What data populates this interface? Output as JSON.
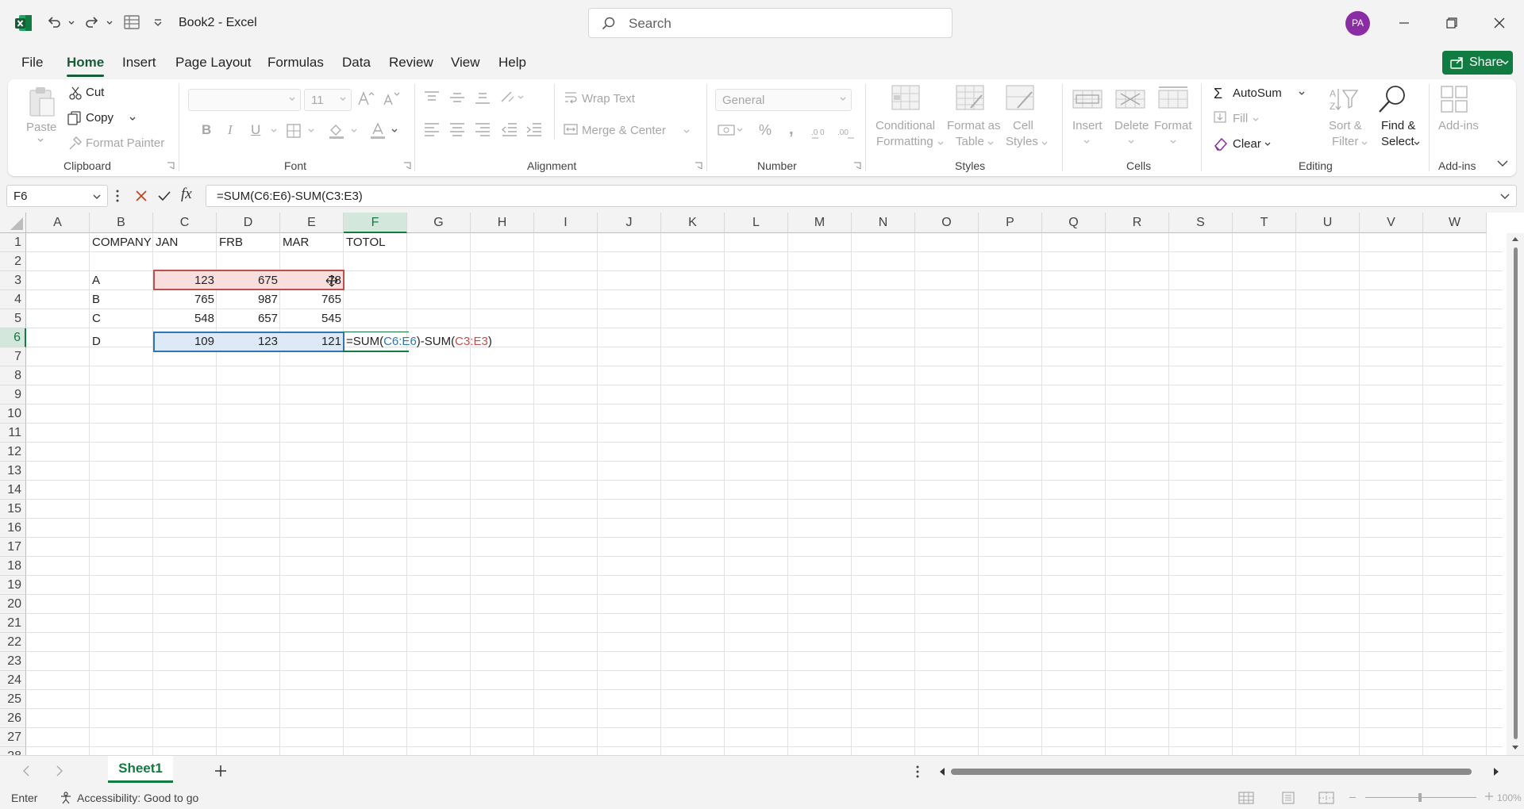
{
  "app": {
    "title": "Book2  -  Excel",
    "search_placeholder": "Search",
    "user_initials": "PA",
    "share_label": "Share"
  },
  "tabs": [
    "File",
    "Home",
    "Insert",
    "Page Layout",
    "Formulas",
    "Data",
    "Review",
    "View",
    "Help"
  ],
  "ribbon": {
    "clipboard": {
      "paste": "Paste",
      "cut": "Cut",
      "copy": "Copy",
      "format_painter": "Format Painter",
      "label": "Clipboard"
    },
    "font": {
      "name": "",
      "size": "11",
      "label": "Font"
    },
    "alignment": {
      "wrap_text": "Wrap Text",
      "merge_center": "Merge & Center",
      "label": "Alignment"
    },
    "number": {
      "format": "General",
      "label": "Number"
    },
    "styles": {
      "conditional_1": "Conditional",
      "conditional_2": "Formatting",
      "format_table_1": "Format as",
      "format_table_2": "Table",
      "cell_styles_1": "Cell",
      "cell_styles_2": "Styles",
      "label": "Styles"
    },
    "cells": {
      "insert": "Insert",
      "delete": "Delete",
      "format": "Format",
      "label": "Cells"
    },
    "editing": {
      "autosum": "AutoSum",
      "fill": "Fill",
      "clear": "Clear",
      "sort_1": "Sort &",
      "sort_2": "Filter",
      "find_1": "Find &",
      "find_2": "Select",
      "label": "Editing"
    },
    "addins": {
      "label_btn": "Add-ins",
      "label": "Add-ins"
    }
  },
  "formula_bar": {
    "name_box": "F6",
    "formula": "=SUM(C6:E6)-SUM(C3:E3)"
  },
  "columns": [
    "A",
    "B",
    "C",
    "D",
    "E",
    "F",
    "G",
    "H",
    "I",
    "J",
    "K",
    "L",
    "M",
    "N",
    "O",
    "P",
    "Q",
    "R",
    "S",
    "T",
    "U",
    "V",
    "W"
  ],
  "rows": [
    "1",
    "2",
    "3",
    "4",
    "5",
    "6",
    "7",
    "8",
    "9",
    "10",
    "11",
    "12",
    "13",
    "14",
    "15",
    "16",
    "17",
    "18",
    "19",
    "20",
    "21",
    "22",
    "23",
    "24",
    "25",
    "26",
    "27",
    "28"
  ],
  "cells": {
    "B1": "COMPANY",
    "C1": "JAN",
    "D1": "FRB",
    "E1": "MAR",
    "F1": "TOTOL",
    "B3": "A",
    "C3": "123",
    "D3": "675",
    "E3": "78",
    "B4": "B",
    "C4": "765",
    "D4": "987",
    "E4": "765",
    "B5": "C",
    "C5": "548",
    "D5": "657",
    "E5": "545",
    "B6": "D",
    "C6": "109",
    "D6": "123",
    "E6": "121",
    "F6_parts": [
      "=SUM(",
      "C6:E6",
      ")-SUM(",
      "C3:E3",
      ")"
    ]
  },
  "colors": {
    "accent": "#107c41",
    "ref_blue": "#2f75b5",
    "ref_red": "#c0504d"
  },
  "sheets": [
    "Sheet1"
  ],
  "status": {
    "mode": "Enter",
    "accessibility": "Accessibility: Good to go",
    "zoom": "100%"
  }
}
